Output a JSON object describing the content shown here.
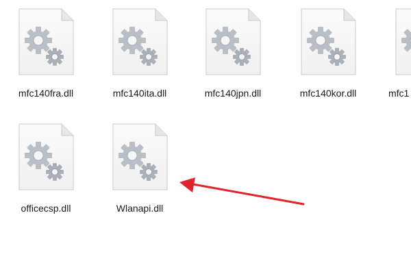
{
  "files": [
    {
      "name": "mfc140fra.dll",
      "icon": "dll-file-icon"
    },
    {
      "name": "mfc140ita.dll",
      "icon": "dll-file-icon"
    },
    {
      "name": "mfc140jpn.dll",
      "icon": "dll-file-icon"
    },
    {
      "name": "mfc140kor.dll",
      "icon": "dll-file-icon"
    },
    {
      "name": "mfc1",
      "icon": "dll-file-icon"
    },
    {
      "name": "officecsp.dll",
      "icon": "dll-file-icon"
    },
    {
      "name": "Wlanapi.dll",
      "icon": "dll-file-icon"
    }
  ],
  "annotation": {
    "icon": "red-arrow-icon",
    "color": "#e0242a"
  }
}
